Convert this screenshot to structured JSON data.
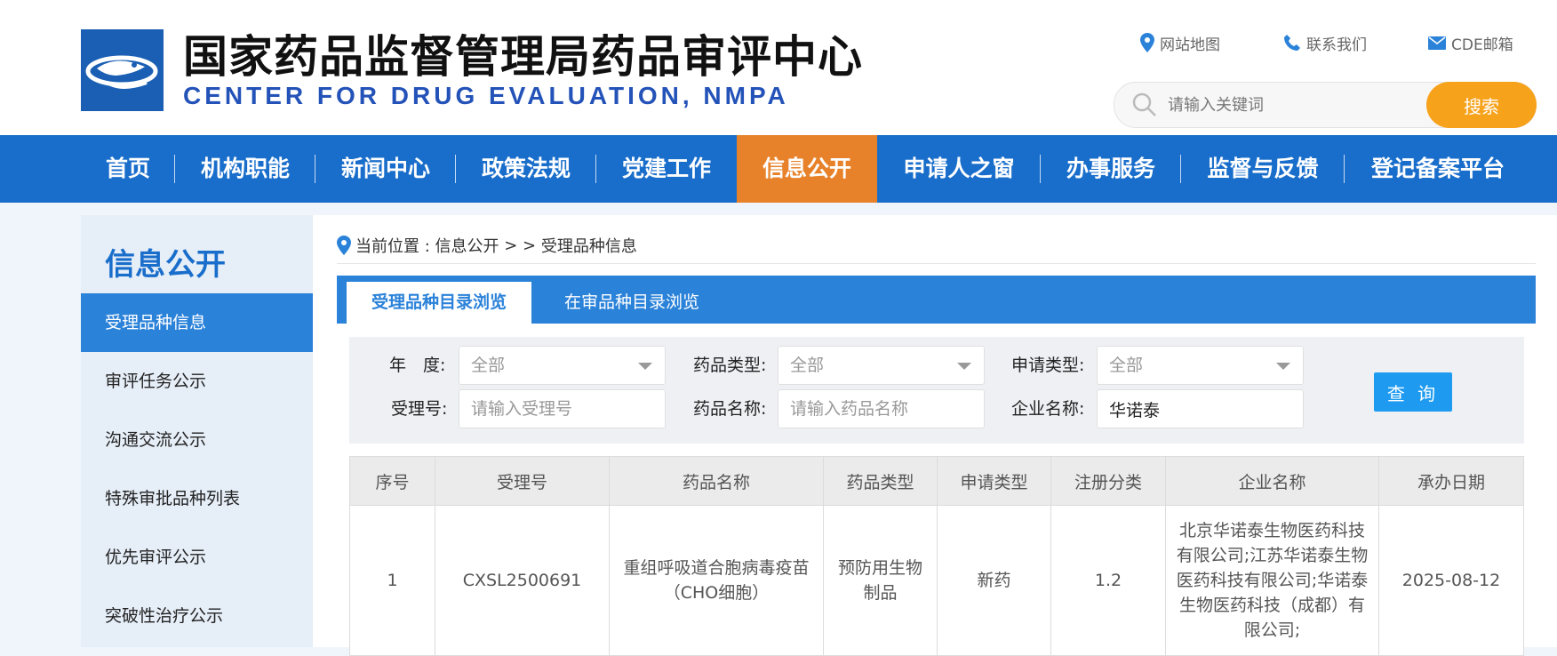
{
  "header": {
    "title_cn": "国家药品监督管理局药品审评中心",
    "title_en": "CENTER FOR DRUG EVALUATION, NMPA",
    "links": [
      {
        "label": "网站地图",
        "icon": "map-pin-icon"
      },
      {
        "label": "联系我们",
        "icon": "phone-icon"
      },
      {
        "label": "CDE邮箱",
        "icon": "mail-icon"
      }
    ],
    "search": {
      "placeholder": "请输入关键词",
      "button": "搜索"
    }
  },
  "nav": {
    "items": [
      "首页",
      "机构职能",
      "新闻中心",
      "政策法规",
      "党建工作",
      "信息公开",
      "申请人之窗",
      "办事服务",
      "监督与反馈",
      "登记备案平台"
    ],
    "active": "信息公开"
  },
  "sidebar": {
    "title": "信息公开",
    "items": [
      "受理品种信息",
      "审评任务公示",
      "沟通交流公示",
      "特殊审批品种列表",
      "优先审评公示",
      "突破性治疗公示"
    ],
    "active": "受理品种信息"
  },
  "breadcrumb": {
    "prefix": "当前位置 : ",
    "section": "信息公开",
    "separator": " > > ",
    "page": "受理品种信息"
  },
  "tabs": [
    "受理品种目录浏览",
    "在审品种目录浏览"
  ],
  "filters": {
    "year_label": "年　度:",
    "year_value": "全部",
    "drug_type_label": "药品类型:",
    "drug_type_value": "全部",
    "apply_type_label": "申请类型:",
    "apply_type_value": "全部",
    "accept_no_label": "受理号:",
    "accept_no_placeholder": "请输入受理号",
    "drug_name_label": "药品名称:",
    "drug_name_placeholder": "请输入药品名称",
    "company_label": "企业名称:",
    "company_value": "华诺泰",
    "query_button": "查 询"
  },
  "table": {
    "columns": [
      "序号",
      "受理号",
      "药品名称",
      "药品类型",
      "申请类型",
      "注册分类",
      "企业名称",
      "承办日期"
    ],
    "rows": [
      [
        "1",
        "CXSL2500691",
        "重组呼吸道合胞病毒疫苗（CHO细胞）",
        "预防用生物制品",
        "新药",
        "1.2",
        "北京华诺泰生物医药科技有限公司;江苏华诺泰生物医药科技有限公司;华诺泰生物医药科技（成都）有限公司;",
        "2025-08-12"
      ]
    ]
  },
  "colors": {
    "nav_bg": "#1a6ecb",
    "nav_active": "#e8822a",
    "accent": "#2b82d9",
    "search_button": "#f7a21b",
    "query_button": "#1e9bf0",
    "title_en": "#2352b8"
  }
}
